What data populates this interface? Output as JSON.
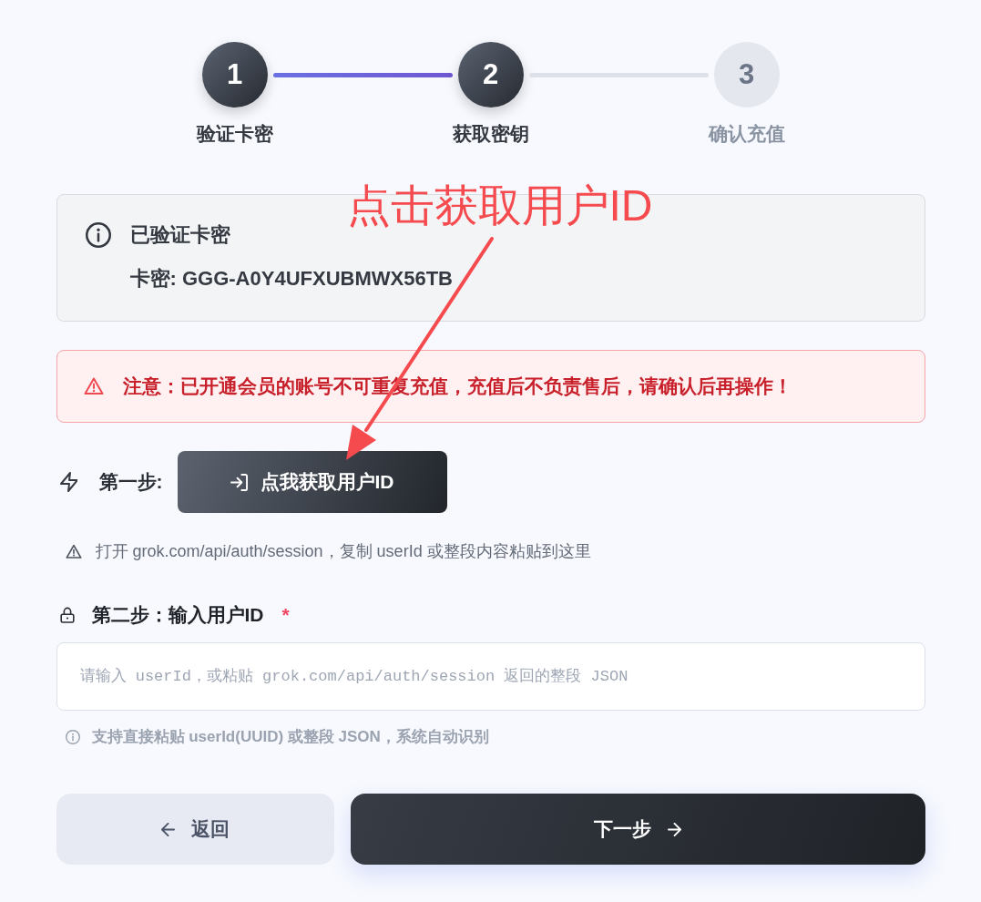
{
  "stepper": {
    "steps": [
      {
        "number": "1",
        "label": "验证卡密",
        "active": true
      },
      {
        "number": "2",
        "label": "获取密钥",
        "active": true
      },
      {
        "number": "3",
        "label": "确认充值",
        "active": false
      }
    ]
  },
  "verified_card": {
    "title": "已验证卡密",
    "key_line": "卡密: GGG-A0Y4UFXUBMWX56TB"
  },
  "warning": {
    "text": "注意：已开通会员的账号不可重复充值，充值后不负责售后，请确认后再操作！"
  },
  "step_one": {
    "label": "第一步:",
    "button": "点我获取用户ID",
    "hint": "打开 grok.com/api/auth/session，复制 userId 或整段内容粘贴到这里"
  },
  "step_two": {
    "label": "第二步：输入用户ID",
    "required_mark": "*",
    "placeholder": "请输入 userId，或粘贴 grok.com/api/auth/session 返回的整段 JSON",
    "help": "支持直接粘贴 userId(UUID) 或整段 JSON，系统自动识别"
  },
  "buttons": [
    {
      "label": "返回",
      "kind": "back"
    },
    {
      "label": "下一步",
      "kind": "next"
    }
  ],
  "annotation": {
    "text": "点击获取用户ID"
  }
}
